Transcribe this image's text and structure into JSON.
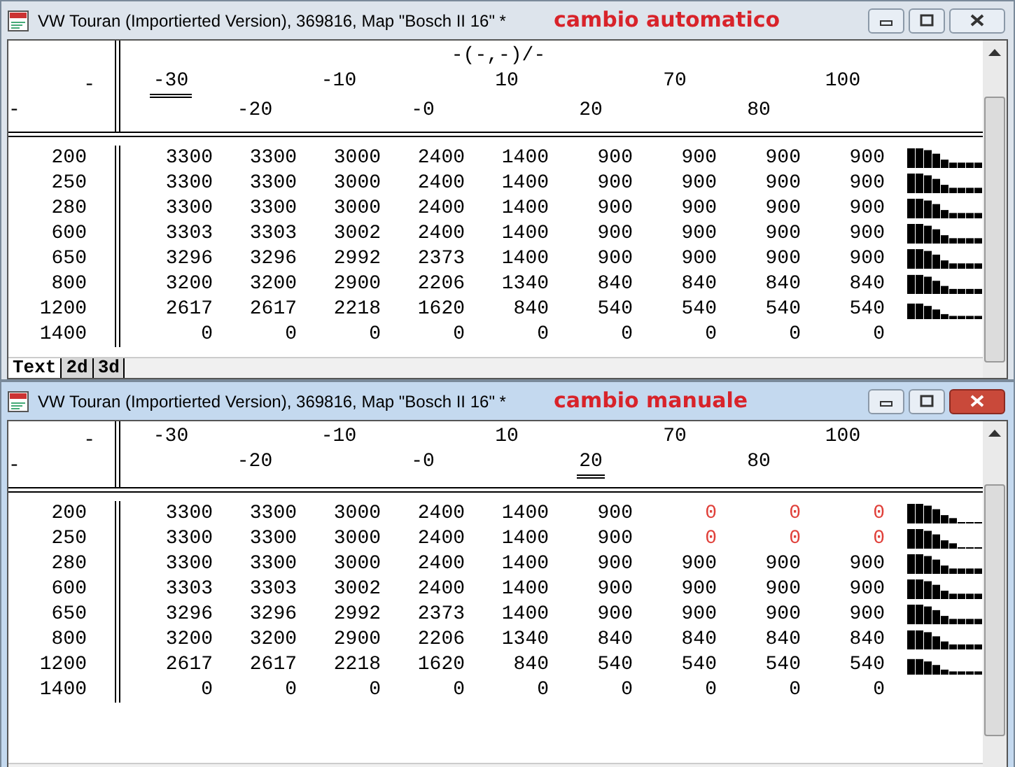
{
  "windows": [
    {
      "title": "VW Touran (Importierted Version), 369816, Map \"Bosch II 16\" *",
      "annotation": "cambio automatico",
      "active": false,
      "axis_title": "-(-,-)/-",
      "row_axis_top": "-",
      "row_axis_bottom": "-",
      "columns": [
        {
          "label": "-30",
          "selected": true
        },
        {
          "label": "-20",
          "selected": false
        },
        {
          "label": "-10",
          "selected": false
        },
        {
          "label": "-0",
          "selected": false
        },
        {
          "label": "10",
          "selected": false
        },
        {
          "label": "20",
          "selected": false
        },
        {
          "label": "70",
          "selected": false
        },
        {
          "label": "80",
          "selected": false
        },
        {
          "label": "100",
          "selected": false
        }
      ],
      "rows": [
        {
          "label": "200",
          "cells": [
            {
              "text": "3300",
              "modified": false
            },
            {
              "text": "3300",
              "modified": false
            },
            {
              "text": "3000",
              "modified": false
            },
            {
              "text": "2400",
              "modified": false
            },
            {
              "text": "1400",
              "modified": false
            },
            {
              "text": "900",
              "modified": false
            },
            {
              "text": "900",
              "modified": false
            },
            {
              "text": "900",
              "modified": false
            },
            {
              "text": "900",
              "modified": false
            }
          ]
        },
        {
          "label": "250",
          "cells": [
            {
              "text": "3300",
              "modified": false
            },
            {
              "text": "3300",
              "modified": false
            },
            {
              "text": "3000",
              "modified": false
            },
            {
              "text": "2400",
              "modified": false
            },
            {
              "text": "1400",
              "modified": false
            },
            {
              "text": "900",
              "modified": false
            },
            {
              "text": "900",
              "modified": false
            },
            {
              "text": "900",
              "modified": false
            },
            {
              "text": "900",
              "modified": false
            }
          ]
        },
        {
          "label": "280",
          "cells": [
            {
              "text": "3300",
              "modified": false
            },
            {
              "text": "3300",
              "modified": false
            },
            {
              "text": "3000",
              "modified": false
            },
            {
              "text": "2400",
              "modified": false
            },
            {
              "text": "1400",
              "modified": false
            },
            {
              "text": "900",
              "modified": false
            },
            {
              "text": "900",
              "modified": false
            },
            {
              "text": "900",
              "modified": false
            },
            {
              "text": "900",
              "modified": false
            }
          ]
        },
        {
          "label": "600",
          "cells": [
            {
              "text": "3303",
              "modified": false
            },
            {
              "text": "3303",
              "modified": false
            },
            {
              "text": "3002",
              "modified": false
            },
            {
              "text": "2400",
              "modified": false
            },
            {
              "text": "1400",
              "modified": false
            },
            {
              "text": "900",
              "modified": false
            },
            {
              "text": "900",
              "modified": false
            },
            {
              "text": "900",
              "modified": false
            },
            {
              "text": "900",
              "modified": false
            }
          ]
        },
        {
          "label": "650",
          "cells": [
            {
              "text": "3296",
              "modified": false
            },
            {
              "text": "3296",
              "modified": false
            },
            {
              "text": "2992",
              "modified": false
            },
            {
              "text": "2373",
              "modified": false
            },
            {
              "text": "1400",
              "modified": false
            },
            {
              "text": "900",
              "modified": false
            },
            {
              "text": "900",
              "modified": false
            },
            {
              "text": "900",
              "modified": false
            },
            {
              "text": "900",
              "modified": false
            }
          ]
        },
        {
          "label": "800",
          "cells": [
            {
              "text": "3200",
              "modified": false
            },
            {
              "text": "3200",
              "modified": false
            },
            {
              "text": "2900",
              "modified": false
            },
            {
              "text": "2206",
              "modified": false
            },
            {
              "text": "1340",
              "modified": false
            },
            {
              "text": "840",
              "modified": false
            },
            {
              "text": "840",
              "modified": false
            },
            {
              "text": "840",
              "modified": false
            },
            {
              "text": "840",
              "modified": false
            }
          ]
        },
        {
          "label": "1200",
          "cells": [
            {
              "text": "2617",
              "modified": false
            },
            {
              "text": "2617",
              "modified": false
            },
            {
              "text": "2218",
              "modified": false
            },
            {
              "text": "1620",
              "modified": false
            },
            {
              "text": "840",
              "modified": false
            },
            {
              "text": "540",
              "modified": false
            },
            {
              "text": "540",
              "modified": false
            },
            {
              "text": "540",
              "modified": false
            },
            {
              "text": "540",
              "modified": false
            }
          ]
        },
        {
          "label": "1400",
          "cells": [
            {
              "text": "0",
              "modified": false
            },
            {
              "text": "0",
              "modified": false
            },
            {
              "text": "0",
              "modified": false
            },
            {
              "text": "0",
              "modified": false
            },
            {
              "text": "0",
              "modified": false
            },
            {
              "text": "0",
              "modified": false
            },
            {
              "text": "0",
              "modified": false
            },
            {
              "text": "0",
              "modified": false
            },
            {
              "text": "0",
              "modified": false
            }
          ]
        }
      ],
      "tabs": [
        {
          "label": "Text",
          "selected": true
        },
        {
          "label": "2d",
          "selected": false
        },
        {
          "label": "3d",
          "selected": false
        }
      ]
    },
    {
      "title": "VW Touran (Importierted Version), 369816, Map \"Bosch II 16\" *",
      "annotation": "cambio manuale",
      "active": true,
      "row_axis_top": "-",
      "row_axis_bottom": "-",
      "columns": [
        {
          "label": "-30",
          "selected": false
        },
        {
          "label": "-20",
          "selected": false
        },
        {
          "label": "-10",
          "selected": false
        },
        {
          "label": "-0",
          "selected": false
        },
        {
          "label": "10",
          "selected": false
        },
        {
          "label": "20",
          "selected": true
        },
        {
          "label": "70",
          "selected": false
        },
        {
          "label": "80",
          "selected": false
        },
        {
          "label": "100",
          "selected": false
        }
      ],
      "rows": [
        {
          "label": "200",
          "cells": [
            {
              "text": "3300",
              "modified": false
            },
            {
              "text": "3300",
              "modified": false
            },
            {
              "text": "3000",
              "modified": false
            },
            {
              "text": "2400",
              "modified": false
            },
            {
              "text": "1400",
              "modified": false
            },
            {
              "text": "900",
              "modified": false
            },
            {
              "text": "0",
              "modified": true
            },
            {
              "text": "0",
              "modified": true
            },
            {
              "text": "0",
              "modified": true
            }
          ]
        },
        {
          "label": "250",
          "cells": [
            {
              "text": "3300",
              "modified": false
            },
            {
              "text": "3300",
              "modified": false
            },
            {
              "text": "3000",
              "modified": false
            },
            {
              "text": "2400",
              "modified": false
            },
            {
              "text": "1400",
              "modified": false
            },
            {
              "text": "900",
              "modified": false
            },
            {
              "text": "0",
              "modified": true
            },
            {
              "text": "0",
              "modified": true
            },
            {
              "text": "0",
              "modified": true
            }
          ]
        },
        {
          "label": "280",
          "cells": [
            {
              "text": "3300",
              "modified": false
            },
            {
              "text": "3300",
              "modified": false
            },
            {
              "text": "3000",
              "modified": false
            },
            {
              "text": "2400",
              "modified": false
            },
            {
              "text": "1400",
              "modified": false
            },
            {
              "text": "900",
              "modified": false
            },
            {
              "text": "900",
              "modified": false
            },
            {
              "text": "900",
              "modified": false
            },
            {
              "text": "900",
              "modified": false
            }
          ]
        },
        {
          "label": "600",
          "cells": [
            {
              "text": "3303",
              "modified": false
            },
            {
              "text": "3303",
              "modified": false
            },
            {
              "text": "3002",
              "modified": false
            },
            {
              "text": "2400",
              "modified": false
            },
            {
              "text": "1400",
              "modified": false
            },
            {
              "text": "900",
              "modified": false
            },
            {
              "text": "900",
              "modified": false
            },
            {
              "text": "900",
              "modified": false
            },
            {
              "text": "900",
              "modified": false
            }
          ]
        },
        {
          "label": "650",
          "cells": [
            {
              "text": "3296",
              "modified": false
            },
            {
              "text": "3296",
              "modified": false
            },
            {
              "text": "2992",
              "modified": false
            },
            {
              "text": "2373",
              "modified": false
            },
            {
              "text": "1400",
              "modified": false
            },
            {
              "text": "900",
              "modified": false
            },
            {
              "text": "900",
              "modified": false
            },
            {
              "text": "900",
              "modified": false
            },
            {
              "text": "900",
              "modified": false
            }
          ]
        },
        {
          "label": "800",
          "cells": [
            {
              "text": "3200",
              "modified": false
            },
            {
              "text": "3200",
              "modified": false
            },
            {
              "text": "2900",
              "modified": false
            },
            {
              "text": "2206",
              "modified": false
            },
            {
              "text": "1340",
              "modified": false
            },
            {
              "text": "840",
              "modified": false
            },
            {
              "text": "840",
              "modified": false
            },
            {
              "text": "840",
              "modified": false
            },
            {
              "text": "840",
              "modified": false
            }
          ]
        },
        {
          "label": "1200",
          "cells": [
            {
              "text": "2617",
              "modified": false
            },
            {
              "text": "2617",
              "modified": false
            },
            {
              "text": "2218",
              "modified": false
            },
            {
              "text": "1620",
              "modified": false
            },
            {
              "text": "840",
              "modified": false
            },
            {
              "text": "540",
              "modified": false
            },
            {
              "text": "540",
              "modified": false
            },
            {
              "text": "540",
              "modified": false
            },
            {
              "text": "540",
              "modified": false
            }
          ]
        },
        {
          "label": "1400",
          "cells": [
            {
              "text": "0",
              "modified": false
            },
            {
              "text": "0",
              "modified": false
            },
            {
              "text": "0",
              "modified": false
            },
            {
              "text": "0",
              "modified": false
            },
            {
              "text": "0",
              "modified": false
            },
            {
              "text": "0",
              "modified": false
            },
            {
              "text": "0",
              "modified": false
            },
            {
              "text": "0",
              "modified": false
            },
            {
              "text": "0",
              "modified": false
            }
          ]
        }
      ]
    }
  ]
}
